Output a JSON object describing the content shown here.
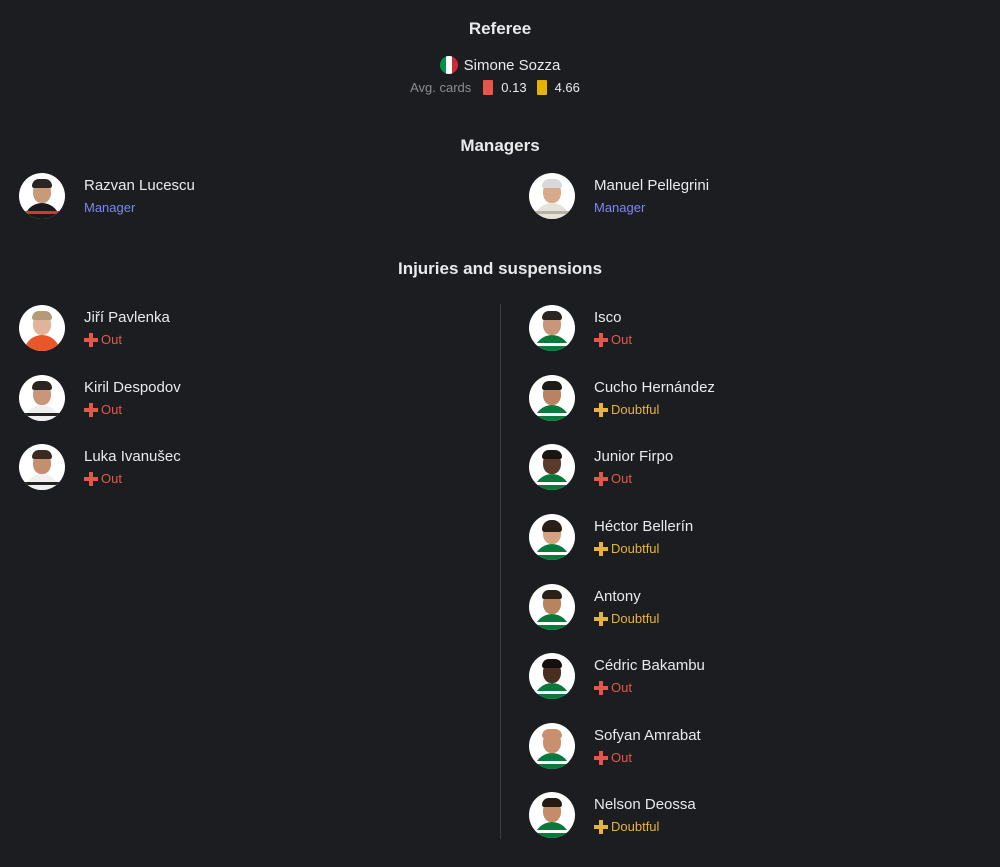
{
  "referee": {
    "title": "Referee",
    "name": "Simone Sozza",
    "flag_colors": [
      "#009246",
      "#ffffff",
      "#ce2b37"
    ],
    "avg_label": "Avg. cards",
    "red_card_value": "0.13",
    "yellow_card_value": "4.66",
    "red_color": "#e5574a",
    "yellow_color": "#e8b200"
  },
  "managers": {
    "title": "Managers",
    "home": {
      "name": "Razvan Lucescu",
      "role": "Manager"
    },
    "away": {
      "name": "Manuel Pellegrini",
      "role": "Manager"
    }
  },
  "injuries": {
    "title": "Injuries and suspensions",
    "home": [
      {
        "name": "Jiří Pavlenka",
        "status": "Out",
        "kind": "out"
      },
      {
        "name": "Kiril Despodov",
        "status": "Out",
        "kind": "out"
      },
      {
        "name": "Luka Ivanušec",
        "status": "Out",
        "kind": "out"
      }
    ],
    "away": [
      {
        "name": "Isco",
        "status": "Out",
        "kind": "out"
      },
      {
        "name": "Cucho Hernández",
        "status": "Doubtful",
        "kind": "doubtful"
      },
      {
        "name": "Junior Firpo",
        "status": "Out",
        "kind": "out"
      },
      {
        "name": "Héctor Bellerín",
        "status": "Doubtful",
        "kind": "doubtful"
      },
      {
        "name": "Antony",
        "status": "Doubtful",
        "kind": "doubtful"
      },
      {
        "name": "Cédric Bakambu",
        "status": "Out",
        "kind": "out"
      },
      {
        "name": "Sofyan Amrabat",
        "status": "Out",
        "kind": "out"
      },
      {
        "name": "Nelson Deossa",
        "status": "Doubtful",
        "kind": "doubtful"
      }
    ]
  },
  "colors": {
    "manager_role": "#7f86f0",
    "status_out": "#e5574a",
    "status_doubtful": "#e8b33a"
  }
}
